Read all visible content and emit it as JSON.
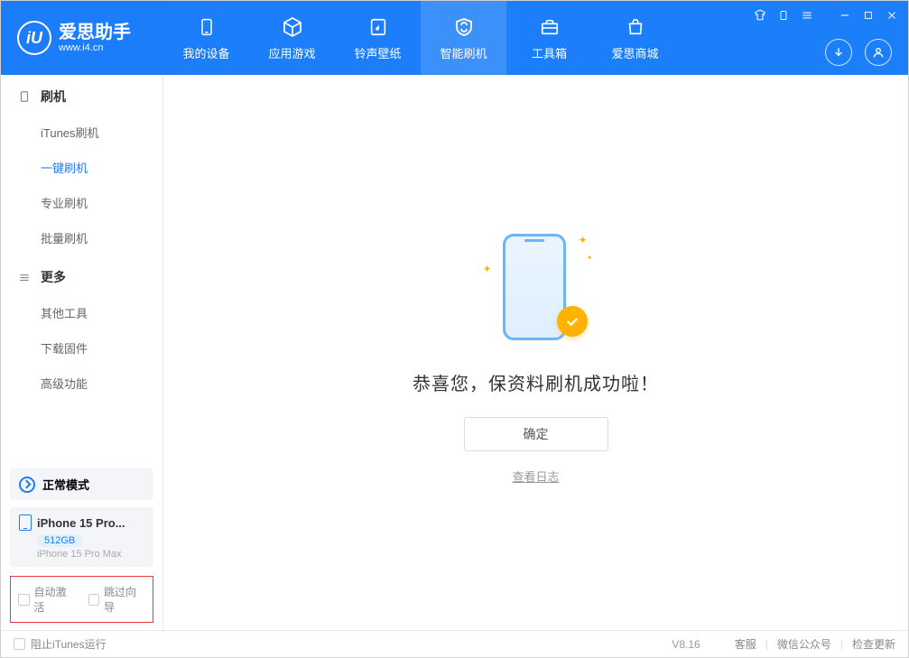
{
  "app": {
    "title": "爱思助手",
    "url": "www.i4.cn"
  },
  "nav": {
    "items": [
      {
        "label": "我的设备"
      },
      {
        "label": "应用游戏"
      },
      {
        "label": "铃声壁纸"
      },
      {
        "label": "智能刷机"
      },
      {
        "label": "工具箱"
      },
      {
        "label": "爱思商城"
      }
    ]
  },
  "sidebar": {
    "section1": {
      "title": "刷机"
    },
    "items1": [
      {
        "label": "iTunes刷机"
      },
      {
        "label": "一键刷机"
      },
      {
        "label": "专业刷机"
      },
      {
        "label": "批量刷机"
      }
    ],
    "section2": {
      "title": "更多"
    },
    "items2": [
      {
        "label": "其他工具"
      },
      {
        "label": "下载固件"
      },
      {
        "label": "高级功能"
      }
    ],
    "mode_label": "正常模式",
    "device": {
      "name": "iPhone 15 Pro...",
      "storage": "512GB",
      "model": "iPhone 15 Pro Max"
    },
    "highlight": {
      "opt1": "自动激活",
      "opt2": "跳过向导"
    }
  },
  "content": {
    "success_message": "恭喜您，保资料刷机成功啦！",
    "confirm_btn": "确定",
    "log_link": "查看日志"
  },
  "footer": {
    "block_itunes": "阻止iTunes运行",
    "version": "V8.16",
    "support": "客服",
    "wechat": "微信公众号",
    "update": "检查更新"
  }
}
